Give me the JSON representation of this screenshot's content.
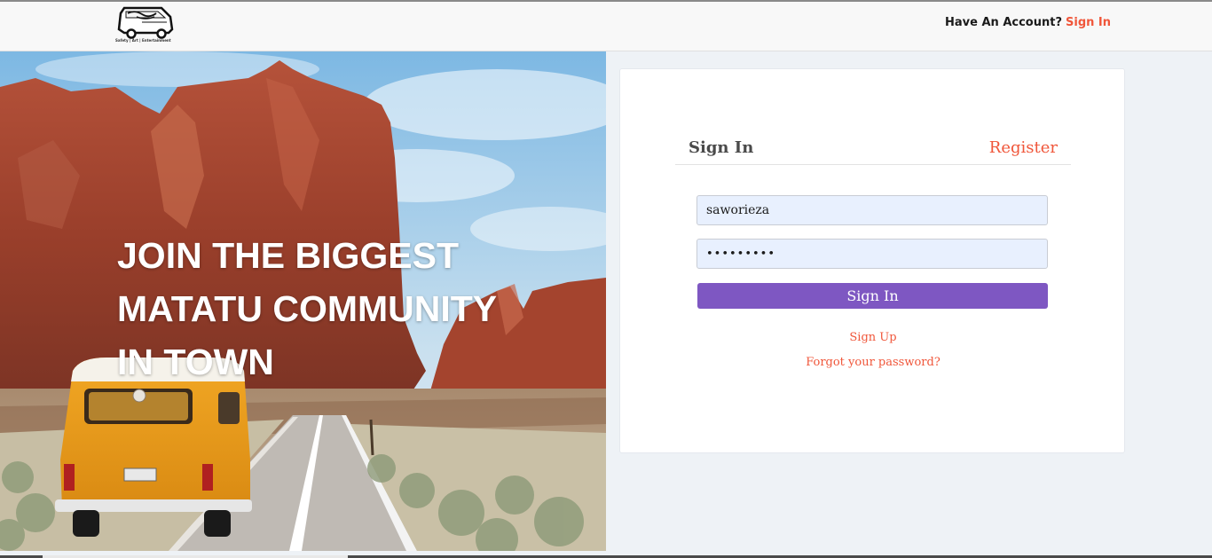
{
  "header": {
    "logo_tagline": "Safety | Art | Entertainment",
    "account_prompt": "Have An Account?",
    "signin_link": "Sign In"
  },
  "hero": {
    "lines": [
      "JOIN THE BIGGEST",
      "MATATU COMMUNITY",
      "IN TOWN"
    ]
  },
  "form": {
    "tabs": {
      "signin": "Sign In",
      "register": "Register"
    },
    "username_value": "saworieza",
    "password_value": "•••••••••",
    "submit_label": "Sign In",
    "signup_link": "Sign Up",
    "forgot_link": "Forgot your password?"
  },
  "colors": {
    "accent": "#f0563a",
    "button": "#7e57c2",
    "input_bg": "#e8f0fe"
  }
}
